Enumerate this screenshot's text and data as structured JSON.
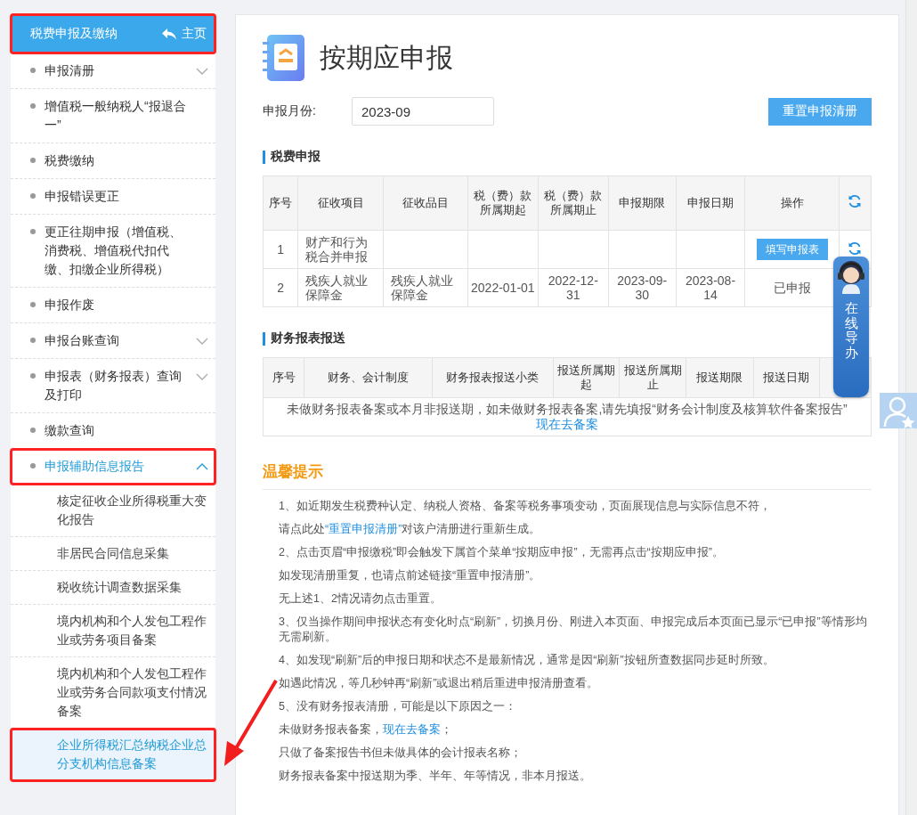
{
  "sidebar": {
    "title": "税费申报及缴纳",
    "highlighted": true,
    "home_link": "主页",
    "items": [
      {
        "label": "申报清册",
        "expandable": true,
        "expanded": false,
        "selected": false,
        "highlighted": false
      },
      {
        "label": "增值税一般纳税人“报退合一”",
        "expandable": false,
        "selected": false,
        "highlighted": false
      },
      {
        "label": "税费缴纳",
        "expandable": false,
        "selected": false,
        "highlighted": false
      },
      {
        "label": "申报错误更正",
        "expandable": false,
        "selected": false,
        "highlighted": false
      },
      {
        "label": "更正往期申报（增值税、消费税、增值税代扣代缴、扣缴企业所得税）",
        "expandable": false,
        "selected": false,
        "highlighted": false
      },
      {
        "label": "申报作废",
        "expandable": false,
        "selected": false,
        "highlighted": false
      },
      {
        "label": "申报台账查询",
        "expandable": true,
        "expanded": false,
        "selected": false,
        "highlighted": false
      },
      {
        "label": "申报表（财务报表）查询及打印",
        "expandable": true,
        "expanded": false,
        "selected": false,
        "highlighted": false
      },
      {
        "label": "缴款查询",
        "expandable": false,
        "selected": false,
        "highlighted": false
      },
      {
        "label": "申报辅助信息报告",
        "expandable": true,
        "expanded": true,
        "selected": true,
        "highlighted": true,
        "children": [
          {
            "label": "核定征收企业所得税重大变化报告",
            "selected": false,
            "highlighted": false
          },
          {
            "label": "非居民合同信息采集",
            "selected": false,
            "highlighted": false
          },
          {
            "label": "税收统计调查数据采集",
            "selected": false,
            "highlighted": false
          },
          {
            "label": "境内机构和个人发包工程作业或劳务项目备案",
            "selected": false,
            "highlighted": false
          },
          {
            "label": "境内机构和个人发包工程作业或劳务合同款项支付情况备案",
            "selected": false,
            "highlighted": false
          },
          {
            "label": "企业所得税汇总纳税企业总分支机构信息备案",
            "selected": true,
            "highlighted": true
          }
        ]
      }
    ]
  },
  "page": {
    "title": "按期应申报",
    "month_label": "申报月份:",
    "month_value": "2023-09",
    "reset_button": "重置申报清册"
  },
  "tax_section": {
    "title": "税费申报",
    "columns": [
      "序号",
      "征收项目",
      "征收品目",
      "税（费）款所属期起",
      "税（费）款所属期止",
      "申报期限",
      "申报日期",
      "操作"
    ],
    "rows": [
      {
        "cells": [
          "1",
          "财产和行为税合并申报",
          "",
          "",
          "",
          "",
          ""
        ],
        "action": {
          "kind": "button",
          "label": "填写申报表"
        },
        "refresh_icon": true
      },
      {
        "cells": [
          "2",
          "残疾人就业保障金",
          "残疾人就业保障金",
          "2022-01-01",
          "2022-12-31",
          "2023-09-30",
          "2023-08-14"
        ],
        "action": {
          "kind": "text",
          "label": "已申报"
        }
      }
    ]
  },
  "finance_section": {
    "title": "财务报表报送",
    "columns": [
      "序号",
      "财务、会计制度",
      "财务报表报送小类",
      "报送所属期起",
      "报送所属期止",
      "报送期限",
      "报送日期"
    ],
    "empty_message": "未做财务报表备案或本月非报送期，如未做财务报表备案,请先填报“财务会计制度及核算软件备案报告”",
    "empty_link": "现在去备案"
  },
  "tips": {
    "title": "温馨提示",
    "lines": [
      [
        {
          "kind": "text",
          "text": "1、如近期发生税费种认定、纳税人资格、备案等税务事项变动，页面展现信息与实际信息不符，"
        }
      ],
      [
        {
          "kind": "text",
          "text": "请点此处"
        },
        {
          "kind": "link",
          "text": "“重置申报清册”"
        },
        {
          "kind": "text",
          "text": "对该户清册进行重新生成。"
        }
      ],
      [
        {
          "kind": "text",
          "text": "2、点击页眉“申报缴税”即会触发下属首个菜单“按期应申报”，无需再点击“按期应申报”。"
        }
      ],
      [
        {
          "kind": "text",
          "text": "如发现清册重复，也请点前述链接“重置申报清册”。"
        }
      ],
      [
        {
          "kind": "text",
          "text": "无上述1、2情况请勿点击重置。"
        }
      ],
      [
        {
          "kind": "text",
          "text": "3、仅当操作期间申报状态有变化时点“刷新”，切换月份、刚进入本页面、申报完成后本页面已显示“已申报”等情形均无需刷新。"
        }
      ],
      [
        {
          "kind": "text",
          "text": "4、如发现“刷新”后的申报日期和状态不是最新情况，通常是因“刷新”按钮所查数据同步延时所致。"
        }
      ],
      [
        {
          "kind": "text",
          "text": "如遇此情况，等几秒钟再“刷新”或退出稍后重进申报清册查看。"
        }
      ],
      [
        {
          "kind": "text",
          "text": "5、没有财务报表清册，可能是以下原因之一："
        }
      ],
      [
        {
          "kind": "text",
          "text": "未做财务报表备案，"
        },
        {
          "kind": "link",
          "text": "现在去备案"
        },
        {
          "kind": "text",
          "text": "；"
        }
      ],
      [
        {
          "kind": "text",
          "text": "只做了备案报告书但未做具体的会计报表名称；"
        }
      ],
      [
        {
          "kind": "text",
          "text": "财务报表备案中报送期为季、半年、年等情况，非本月报送。"
        }
      ]
    ]
  },
  "floating_widget": {
    "label": "在线导办"
  }
}
